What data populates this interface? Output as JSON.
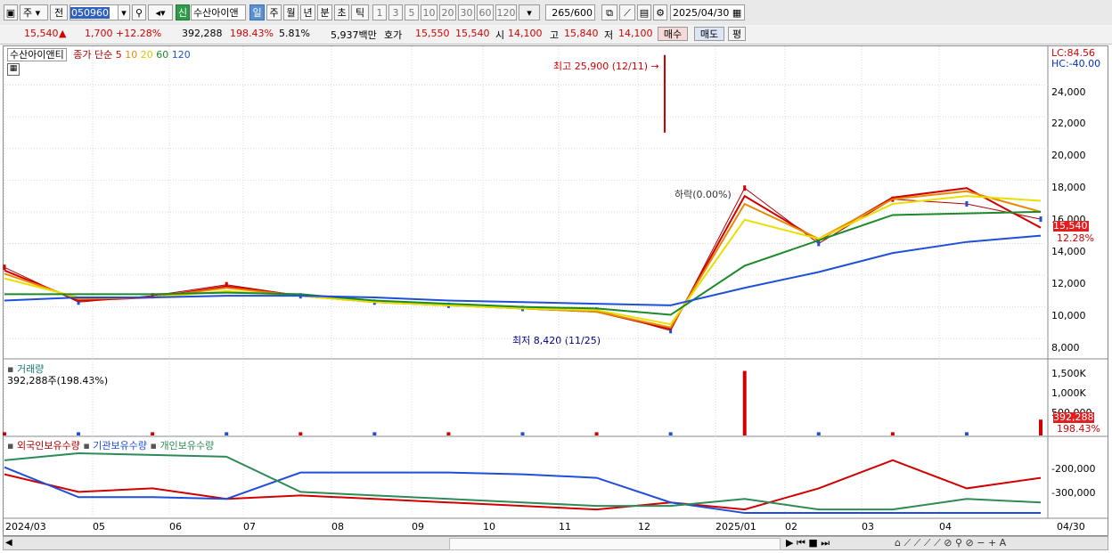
{
  "toolbar": {
    "market": "주",
    "prev": "전",
    "code": "050960",
    "new_badge": "신",
    "stock_name": "수산아이앤",
    "periods": [
      "일",
      "주",
      "월",
      "년",
      "분",
      "초",
      "틱"
    ],
    "minutes": [
      "1",
      "3",
      "5",
      "10",
      "20",
      "30",
      "60",
      "120"
    ],
    "count": "265",
    "count_max": "/600",
    "date": "2025/04/30"
  },
  "info": {
    "price": "15,540",
    "arrow": "▲",
    "change": "1,700",
    "change_pct": "+12.28%",
    "volume": "392,288",
    "volume_pct": "198.43%",
    "turnover": "5.81%",
    "amount": "5,937백만",
    "quote_label": "호가",
    "ask": "15,550",
    "bid": "15,540",
    "open_label": "시",
    "open": "14,100",
    "high_label": "고",
    "high": "15,840",
    "low_label": "저",
    "low": "14,100",
    "buy": "매수",
    "sell": "매도",
    "avg": "평"
  },
  "legend": {
    "stock": "수산아이앤티",
    "ma_label": "종가 단순",
    "ma_periods": [
      "5",
      "10",
      "20",
      "60",
      "120"
    ],
    "ma_colors": [
      "#d00000",
      "#e88a00",
      "#e8e000",
      "#1a8a2a",
      "#1f4fd8"
    ]
  },
  "lc_hc": {
    "lc": "LC:84.56",
    "hc": "HC:-40.00"
  },
  "annotations": {
    "high": "최고 25,900 (12/11)",
    "low": "최저 8,420 (11/25)",
    "drop": "하락(0.00%)"
  },
  "price_axis": [
    "24,000",
    "22,000",
    "20,000",
    "18,000",
    "16,000",
    "14,000",
    "12,000",
    "10,000",
    "8,000"
  ],
  "price_tag": {
    "price": "15,540",
    "pct": "12.28%"
  },
  "volume_panel": {
    "title": "거래량",
    "value": "392,288주(198.43%)",
    "axis": [
      "1,500K",
      "1,000K",
      "500,000"
    ],
    "tag": "392,288",
    "tag_pct": "198.43%"
  },
  "holdings_panel": {
    "series": [
      "외국인보유수량",
      "기관보유수량",
      "개인보유수량"
    ],
    "axis": [
      "-200,000",
      "-300,000"
    ]
  },
  "x_axis": [
    "2024/03",
    "05",
    "06",
    "07",
    "08",
    "09",
    "10",
    "11",
    "12",
    "2025/01",
    "02",
    "03",
    "04"
  ],
  "x_axis_end": "04/30",
  "chart_data": {
    "type": "line",
    "title": "수산아이앤티",
    "x": [
      "2024/03",
      "04",
      "05",
      "06",
      "07",
      "08",
      "09",
      "10",
      "11",
      "12",
      "2025/01",
      "02",
      "03",
      "04",
      "04/30"
    ],
    "series": [
      {
        "name": "종가",
        "values": [
          12500,
          10300,
          10700,
          11400,
          10700,
          10300,
          10100,
          9900,
          9800,
          8500,
          17500,
          14000,
          16800,
          16500,
          15540
        ]
      },
      {
        "name": "5",
        "values": [
          12300,
          10400,
          10600,
          11300,
          10700,
          10300,
          10100,
          9900,
          9700,
          8600,
          17000,
          14200,
          16900,
          17500,
          15000
        ]
      },
      {
        "name": "10",
        "values": [
          12100,
          10500,
          10600,
          11200,
          10700,
          10300,
          10100,
          9900,
          9700,
          8700,
          16500,
          14300,
          16800,
          17300,
          16000
        ]
      },
      {
        "name": "20",
        "values": [
          11800,
          10600,
          10600,
          11000,
          10700,
          10300,
          10100,
          9900,
          9800,
          8900,
          15500,
          14300,
          16500,
          17000,
          16700
        ]
      },
      {
        "name": "60",
        "values": [
          10800,
          10800,
          10800,
          10900,
          10800,
          10400,
          10200,
          10000,
          9900,
          9500,
          12600,
          14200,
          15800,
          15900,
          16000
        ]
      },
      {
        "name": "120",
        "values": [
          10400,
          10600,
          10600,
          10700,
          10700,
          10600,
          10400,
          10300,
          10200,
          10100,
          11200,
          12200,
          13400,
          14100,
          14500
        ]
      }
    ],
    "high": {
      "value": 25900,
      "date": "12/11"
    },
    "low": {
      "value": 8420,
      "date": "11/25"
    },
    "ylim": [
      7000,
      26000
    ],
    "volume": {
      "ylim": [
        0,
        1700000
      ],
      "peak": 1600000,
      "last": 392288
    },
    "holdings": [
      {
        "name": "외국인보유수량",
        "color": "#d00000",
        "values": [
          -220000,
          -270000,
          -260000,
          -290000,
          -280000,
          -290000,
          -300000,
          -310000,
          -320000,
          -300000,
          -320000,
          -260000,
          -180000,
          -260000,
          -230000
        ]
      },
      {
        "name": "기관보유수량",
        "color": "#1f4fd8",
        "values": [
          -200000,
          -285000,
          -285000,
          -290000,
          -215000,
          -215000,
          -215000,
          -220000,
          -230000,
          -300000,
          -330000,
          -330000,
          -330000,
          -330000,
          -330000
        ]
      },
      {
        "name": "개인보유수량",
        "color": "#2e8b57",
        "values": [
          -180000,
          -160000,
          -165000,
          -170000,
          -270000,
          -280000,
          -290000,
          -300000,
          -310000,
          -310000,
          -290000,
          -320000,
          -320000,
          -290000,
          -300000
        ]
      }
    ],
    "grid": true
  }
}
